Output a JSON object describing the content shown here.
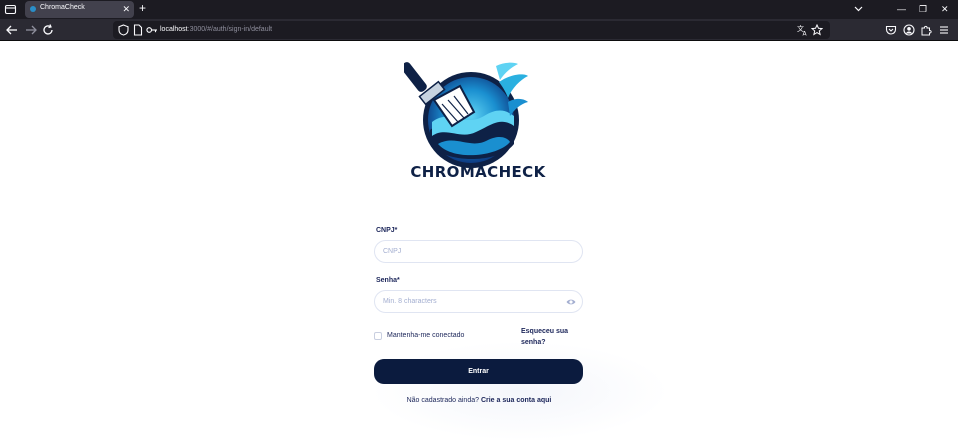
{
  "browser": {
    "tab_title": "ChromaCheck",
    "tab_close": "✕",
    "new_tab": "+",
    "url_host": "localhost",
    "url_path": ":3000/#/auth/sign-in/default",
    "window_controls": [
      "—",
      "❐",
      "✕"
    ],
    "icons": [
      "list-all-tabs-icon",
      "back-icon",
      "forward-icon",
      "reload-icon",
      "shield-icon",
      "page-icon",
      "key-icon",
      "translate-icon",
      "star-icon",
      "pocket-icon",
      "account-icon",
      "extensions-icon",
      "menu-icon"
    ]
  },
  "brand": {
    "name": "CHROMACHECK",
    "colors": {
      "navy": "#0e2146",
      "blue": "#1a8fd0",
      "cyan": "#5fd3f3"
    }
  },
  "form": {
    "cnpj_label": "CNPJ*",
    "cnpj_placeholder": "CNPJ",
    "password_label": "Senha*",
    "password_placeholder": "Min. 8 characters",
    "remember_label": "Mantenha-me conectado",
    "remember_checked": false,
    "forgot_label": "Esqueceu sua senha?",
    "submit_label": "Entrar",
    "signup_prompt": "Não cadastrado ainda?",
    "signup_link": "Crie a sua conta aqui",
    "button_color": "#0b1b3e"
  }
}
